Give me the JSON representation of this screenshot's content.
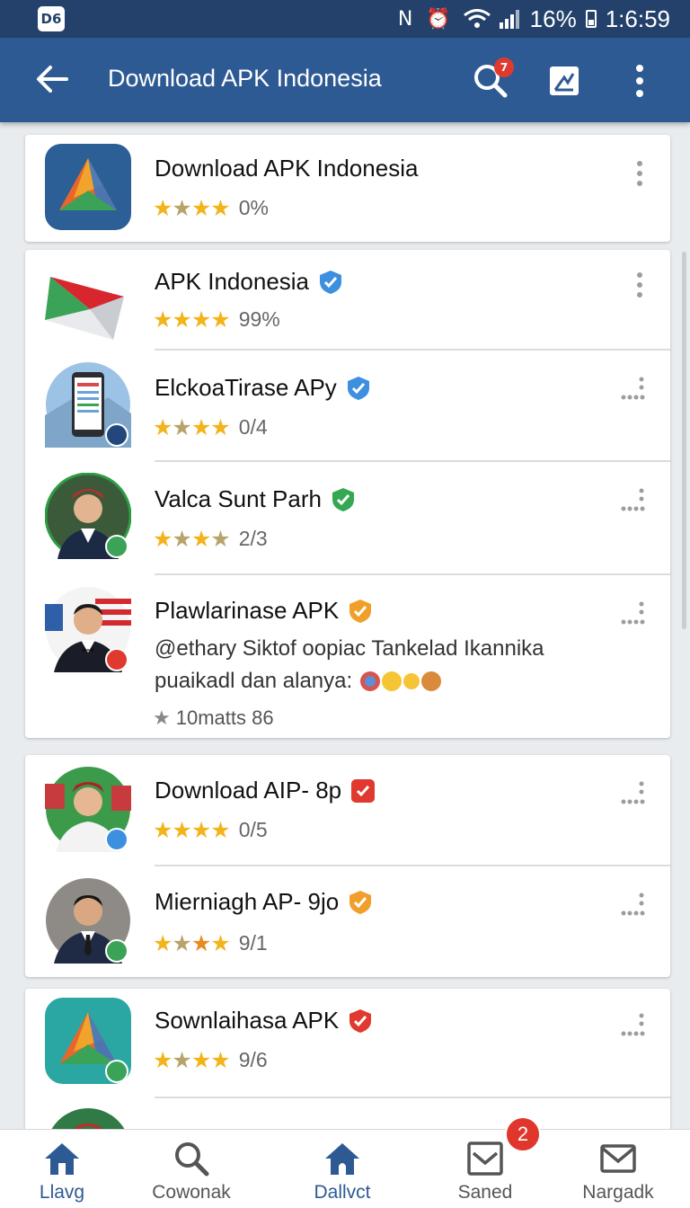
{
  "status_bar": {
    "left_badge": "D6",
    "battery": "16%",
    "time": "1:6:59",
    "icons": [
      "nfc-icon",
      "alarm-icon",
      "wifi-icon",
      "signal-icon",
      "battery-icon"
    ]
  },
  "app_bar": {
    "title": "Download APK Indonesia",
    "search_badge": "7"
  },
  "apps": [
    {
      "name": "Download APK Indonesia",
      "rating": "0%",
      "stars": 4,
      "verified": "",
      "icon": "apk-triangle-icon"
    },
    {
      "name": "APK Indonesia",
      "rating": "99%",
      "stars": 4,
      "verified": "blue",
      "icon": "mail-envelope-icon"
    },
    {
      "name": "ElckoaTirase APy",
      "rating": "0/4",
      "stars": 4,
      "verified": "blue",
      "icon": "phone-app-icon"
    },
    {
      "name": "Valca Sunt Parh",
      "rating": "2/3",
      "stars": 4,
      "verified": "green",
      "icon": "man-avatar-icon"
    },
    {
      "name": "Plawlarinase APK",
      "rating": "",
      "stars": 0,
      "verified": "orange",
      "icon": "man-avatar-icon",
      "description_line1": "@ethary Siktof oopiac Tankelad Ikannika",
      "description_line2": "puaikadl dan alanya:",
      "meta": "10matts 86"
    },
    {
      "name": "Download AIP- 8p",
      "rating": "0/5",
      "stars": 4,
      "verified": "red",
      "icon": "man-avatar-icon"
    },
    {
      "name": "Mierniagh AP- 9jo",
      "rating": "9/1",
      "stars": 4,
      "verified": "orange",
      "icon": "man-avatar-icon"
    },
    {
      "name": "Sownlaihasa APK",
      "rating": "9/6",
      "stars": 4,
      "verified": "red",
      "icon": "apk-triangle-icon"
    }
  ],
  "bottom_nav": [
    {
      "label": "Llavg",
      "icon": "home-icon",
      "active": true
    },
    {
      "label": "Cowonak",
      "icon": "search-icon",
      "active": false
    },
    {
      "label": "Dallvct",
      "icon": "home-icon",
      "active": true
    },
    {
      "label": "Saned",
      "icon": "inbox-icon",
      "active": false
    },
    {
      "label": "Nargadk",
      "icon": "mail-icon",
      "active": false
    }
  ],
  "nav_badge": "2",
  "colors": {
    "app_bar": "#2e5a94",
    "status_bar": "#23416a",
    "star": "#f3b41b",
    "verified_blue": "#3d8fe0",
    "verified_green": "#34a853",
    "verified_orange": "#f0a02a",
    "verified_red": "#e0392f"
  }
}
